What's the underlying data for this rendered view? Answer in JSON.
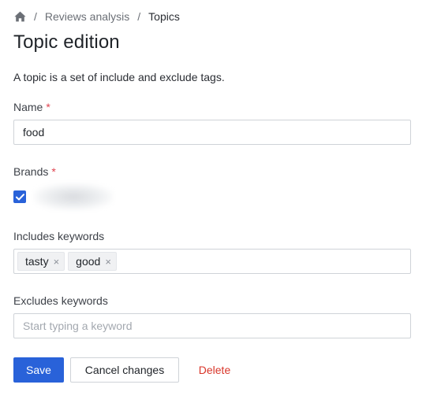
{
  "breadcrumb": {
    "home_icon": "home-icon",
    "items": [
      "Reviews analysis",
      "Topics"
    ]
  },
  "page": {
    "title": "Topic edition",
    "intro": "A topic is a set of include and exclude tags."
  },
  "form": {
    "name": {
      "label": "Name",
      "required": "*",
      "value": "food"
    },
    "brands": {
      "label": "Brands",
      "required": "*",
      "checked": true
    },
    "includes": {
      "label": "Includes keywords",
      "tags": [
        "tasty",
        "good"
      ],
      "remove_glyph": "×"
    },
    "excludes": {
      "label": "Excludes keywords",
      "placeholder": "Start typing a keyword",
      "value": ""
    }
  },
  "actions": {
    "save": "Save",
    "cancel": "Cancel changes",
    "delete": "Delete"
  },
  "colors": {
    "primary": "#2962d9",
    "danger": "#d9362a",
    "required": "#e0434f"
  }
}
